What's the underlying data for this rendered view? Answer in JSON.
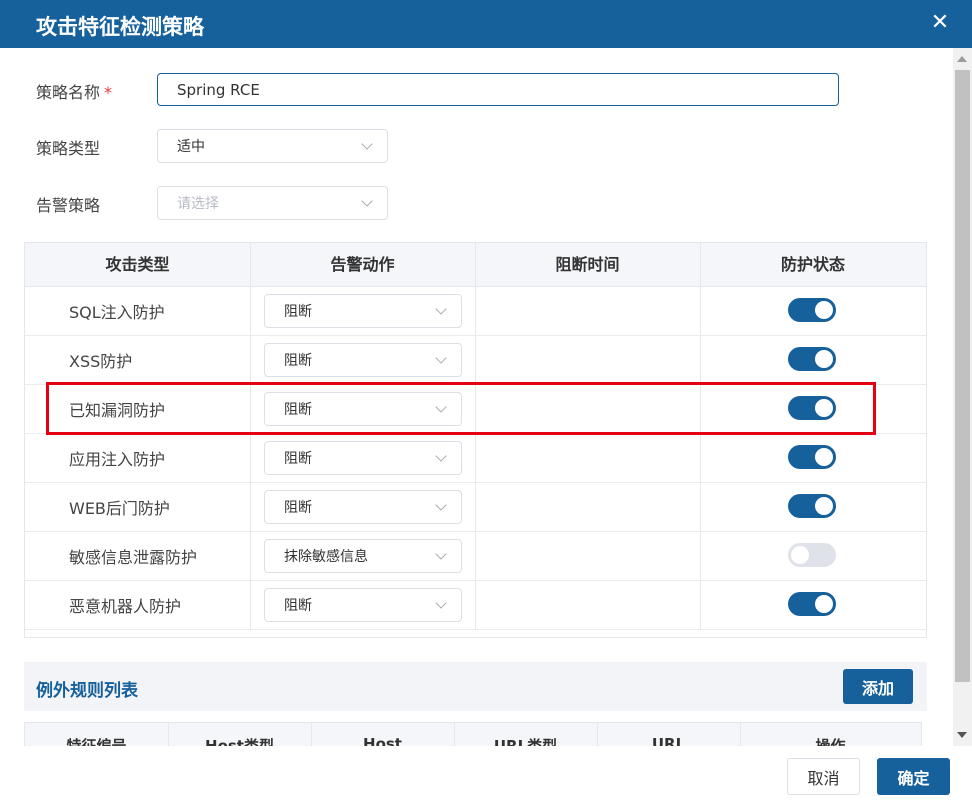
{
  "dialog": {
    "title": "攻击特征检测策略",
    "close_icon": "close-icon"
  },
  "form": {
    "name_label": "策略名称",
    "required_mark": "*",
    "name_value": "Spring RCE",
    "type_label": "策略类型",
    "type_value": "适中",
    "alert_label": "告警策略",
    "alert_placeholder": "请选择"
  },
  "table": {
    "headers": [
      "攻击类型",
      "告警动作",
      "阻断时间",
      "防护状态"
    ],
    "rows": [
      {
        "type": "SQL注入防护",
        "action": "阻断",
        "block_time": "",
        "enabled": true
      },
      {
        "type": "XSS防护",
        "action": "阻断",
        "block_time": "",
        "enabled": true
      },
      {
        "type": "已知漏洞防护",
        "action": "阻断",
        "block_time": "",
        "enabled": true
      },
      {
        "type": "应用注入防护",
        "action": "阻断",
        "block_time": "",
        "enabled": true
      },
      {
        "type": "WEB后门防护",
        "action": "阻断",
        "block_time": "",
        "enabled": true
      },
      {
        "type": "敏感信息泄露防护",
        "action": "抹除敏感信息",
        "block_time": "",
        "enabled": false
      },
      {
        "type": "恶意机器人防护",
        "action": "阻断",
        "block_time": "",
        "enabled": true
      }
    ]
  },
  "exceptions": {
    "title": "例外规则列表",
    "add_label": "添加",
    "headers": [
      "特征编号",
      "Host类型",
      "Host",
      "URL类型",
      "URL",
      "操作"
    ]
  },
  "footer": {
    "cancel_label": "取消",
    "ok_label": "确定"
  },
  "colors": {
    "primary": "#16609c",
    "highlight": "#e50012",
    "toggle_off": "#dfe2e8"
  }
}
